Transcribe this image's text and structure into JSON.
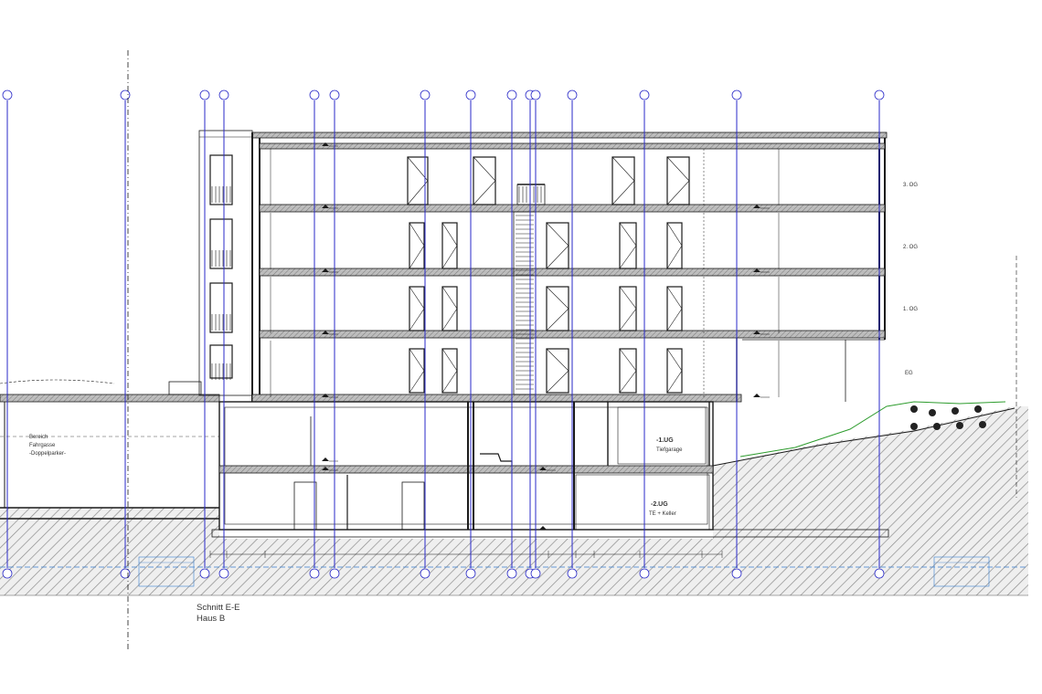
{
  "title": {
    "line1": "Schnitt E-E",
    "line2": "Haus B"
  },
  "floor_labels": {
    "og3": "3. OG",
    "og2": "2. OG",
    "og1": "1. OG",
    "eg": "EG"
  },
  "basement_labels": {
    "ug1_line1": "-1.UG",
    "ug1_line2": "Tiefgarage",
    "ug2_line1": "-2.UG",
    "ug2_line2": "TE + Keller"
  },
  "left_area": {
    "line1": "Bereich",
    "line2": "Fahrgasse",
    "line3": "-Doppelparker-"
  },
  "colors": {
    "ink": "#1a1a1a",
    "grid_axis": "#2a2ac8",
    "ground_hatch": "#8c8c8c",
    "vegetation": "#2e9c2e",
    "ref_blue": "#3a7fd0"
  },
  "icons": [
    "grid-axis-bubble-icon",
    "level-marker-icon",
    "shrub-icon",
    "window-icon",
    "door-icon"
  ]
}
